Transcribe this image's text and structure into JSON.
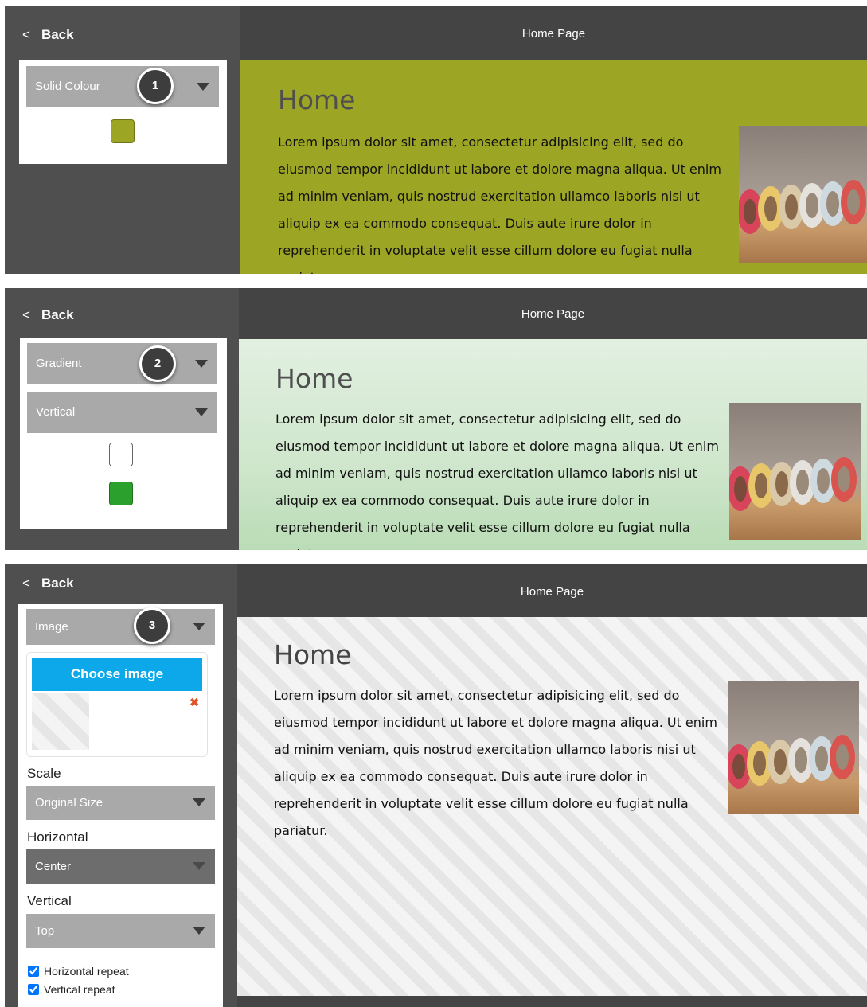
{
  "panels": [
    {
      "back_label": "Back",
      "header_title": "Home Page",
      "background_type": "Solid Colour",
      "step": "1",
      "swatch_colors": [
        "#9da524"
      ],
      "page_heading": "Home",
      "body_text": "Lorem ipsum dolor sit amet, consectetur adipisicing elit, sed do eiusmod tempor incididunt ut labore et dolore magna aliqua. Ut enim ad minim veniam, quis nostrud exercitation ullamco laboris nisi ut aliquip ex ea commodo consequat. Duis aute irure dolor in reprehenderit in voluptate velit esse cillum dolore eu fugiat nulla pariatur.",
      "canvas_background": "#9da524"
    },
    {
      "back_label": "Back",
      "header_title": "Home Page",
      "background_type": "Gradient",
      "step": "2",
      "gradient_direction": "Vertical",
      "swatch_colors": [
        "#ffffff",
        "#2ca02c"
      ],
      "page_heading": "Home",
      "body_text": "Lorem ipsum dolor sit amet, consectetur adipisicing elit, sed do eiusmod tempor incididunt ut labore et dolore magna aliqua. Ut enim ad minim veniam, quis nostrud exercitation ullamco laboris nisi ut aliquip ex ea commodo consequat. Duis aute irure dolor in reprehenderit in voluptate velit esse cillum dolore eu fugiat nulla pariatur.",
      "canvas_background": "vertical gradient #ffffff to #2ca02c"
    },
    {
      "back_label": "Back",
      "header_title": "Home Page",
      "background_type": "Image",
      "step": "3",
      "choose_image_label": "Choose image",
      "remove_icon": "close-icon",
      "scale_label": "Scale",
      "scale_value": "Original Size",
      "horizontal_label": "Horizontal",
      "horizontal_value": "Center",
      "vertical_label": "Vertical",
      "vertical_value": "Top",
      "horizontal_repeat_label": "Horizontal repeat",
      "horizontal_repeat_checked": true,
      "vertical_repeat_label": "Vertical repeat",
      "vertical_repeat_checked": true,
      "page_heading": "Home",
      "body_text": "Lorem ipsum dolor sit amet, consectetur adipisicing elit, sed do eiusmod tempor incididunt ut labore et dolore magna aliqua. Ut enim ad minim veniam, quis nostrud exercitation ullamco laboris nisi ut aliquip ex ea commodo consequat. Duis aute irure dolor in reprehenderit in voluptate velit esse cillum dolore eu fugiat nulla pariatur.",
      "canvas_background": "diagonal stripes light grey"
    }
  ],
  "colors": {
    "sidebar": "#4f4f4f",
    "topbar": "#444444",
    "accent_button": "#0da8e9",
    "dropdown": "#a9a9a9"
  }
}
